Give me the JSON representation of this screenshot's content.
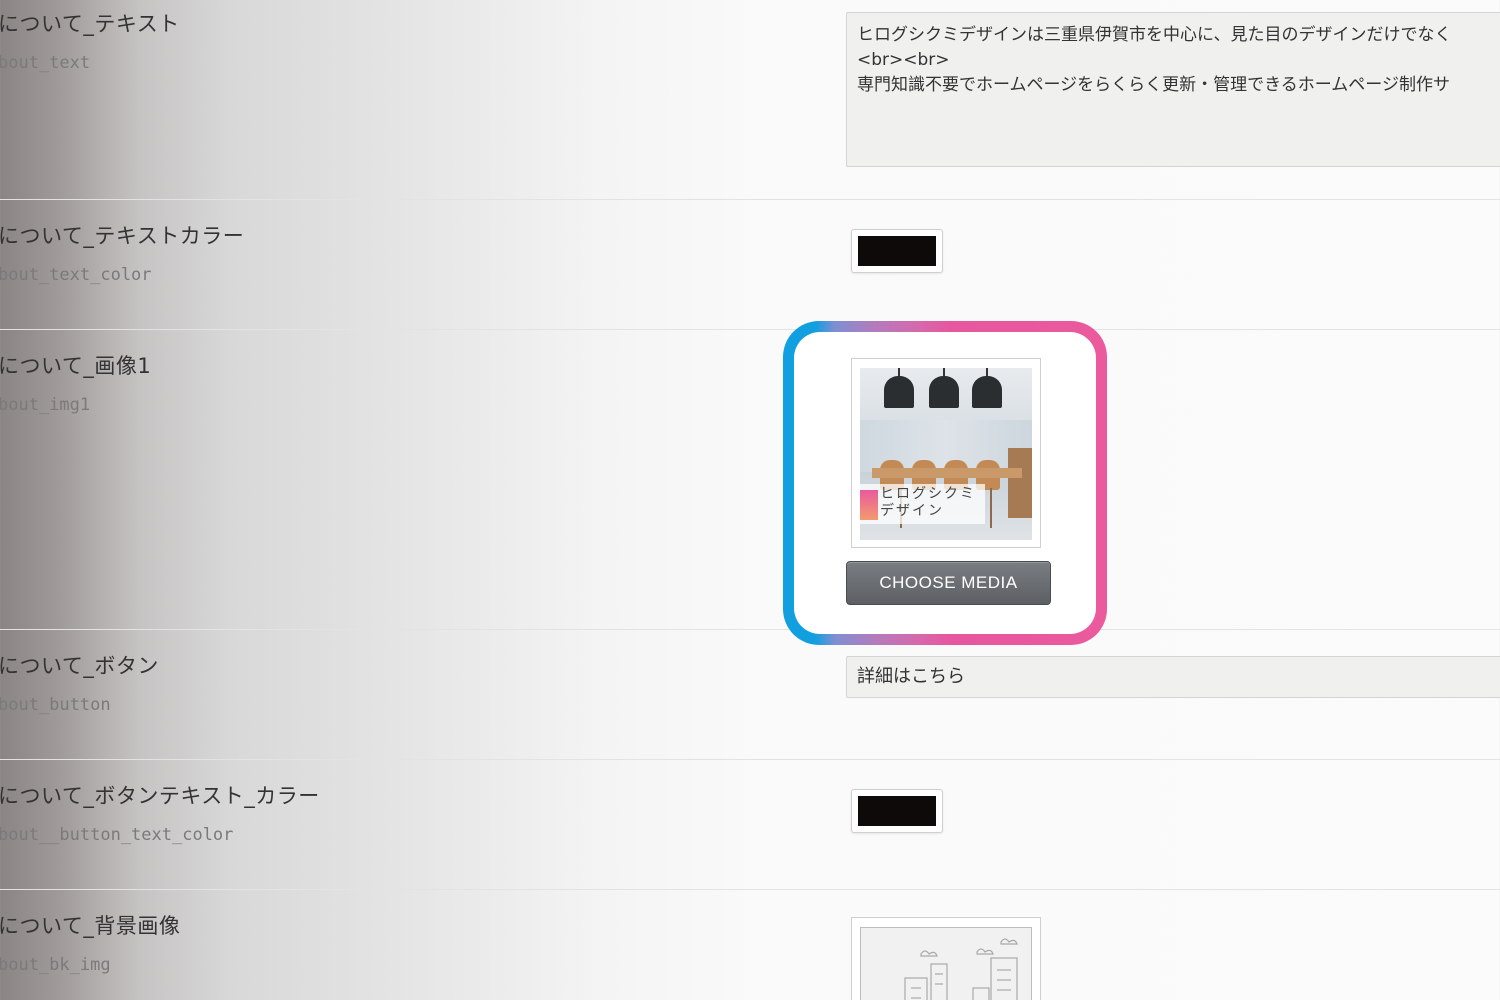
{
  "fields": {
    "about_text": {
      "label": "について_テキスト",
      "key": "bout_text",
      "value_lines": [
        "ヒログシクミデザインは三重県伊賀市を中心に、見た目のデザインだけでなく",
        "<br><br>",
        "専門知識不要でホームページをらくらく更新・管理できるホームページ制作サ"
      ]
    },
    "about_text_color": {
      "label": "について_テキストカラー",
      "key": "bout_text_color",
      "value": "#0e0a09"
    },
    "about_img1": {
      "label": "について_画像1",
      "key": "bout_img1",
      "thumbnail_text_lines": [
        "ヒログシクミ",
        "デザイン"
      ],
      "choose_label": "CHOOSE MEDIA"
    },
    "about_button": {
      "label": "について_ボタン",
      "key": "bout_button",
      "value": "詳細はこちら"
    },
    "about_button_text_color": {
      "label": "について_ボタンテキスト_カラー",
      "key": "bout__button_text_color",
      "value": "#0e0a09"
    },
    "about_bk_img": {
      "label": "について_背景画像",
      "key": "bout_bk_img"
    }
  },
  "highlight_colors": {
    "left": "#129fe0",
    "right": "#ea5a9c"
  },
  "icons": {
    "thumbnail_logo": "brand-logo-icon",
    "bg_image": "city-illustration-icon"
  }
}
